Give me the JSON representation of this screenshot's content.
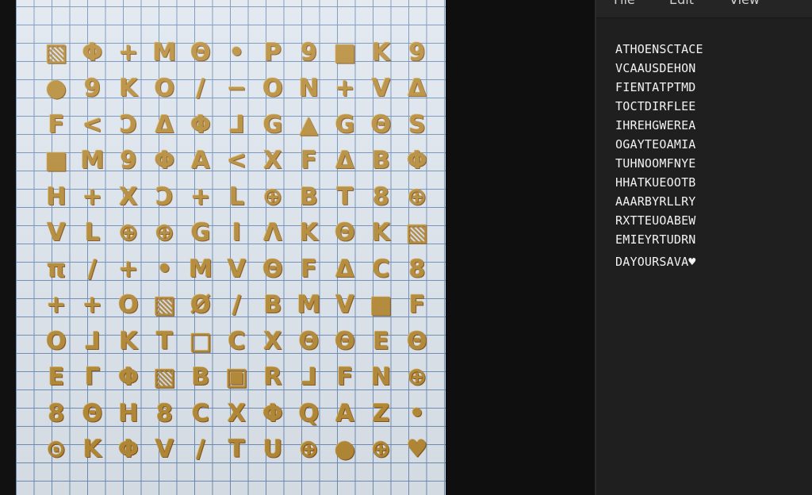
{
  "menu": [
    "File",
    "Edit",
    "View"
  ],
  "lines": [
    "ATHOENSCTACE",
    "VCAAUSDEHON",
    "FIENTATPTMD",
    "TOCTDIRFLEE",
    "IHREHGWEREA",
    "OGAYTEOAMIA",
    "TUHNOOMFNYE",
    "HHATKUEOOTB",
    "AAARBYRLLRY",
    "RXTTEUOABEW",
    "EMIEYRTUDRN",
    "DAYOURSAVA♥"
  ],
  "glyph_rows": [
    [
      "▧",
      "Φ",
      "+",
      "M",
      "Θ",
      "•",
      "P",
      "9",
      "■",
      "K",
      "9"
    ],
    [
      "●",
      "9",
      "K",
      "O",
      "/",
      "−",
      "O",
      "N",
      "+",
      "V",
      "Δ"
    ],
    [
      "F",
      "<",
      "Ɔ",
      "Δ",
      "Φ",
      "⅃",
      "G",
      "▲",
      "G",
      "Θ",
      "S"
    ],
    [
      "■",
      "M",
      "9",
      "Φ",
      "A",
      "<",
      "X",
      "F",
      "Δ",
      "B",
      "Φ"
    ],
    [
      "H",
      "+",
      "X",
      "Ɔ",
      "+",
      "L",
      "⊕",
      "B",
      "T",
      "8",
      "⊕"
    ],
    [
      "V",
      "L",
      "⊕",
      "⊕",
      "G",
      "I",
      "Λ",
      "K",
      "Θ",
      "K",
      "▧"
    ],
    [
      "π",
      "/",
      "+",
      "•",
      "M",
      "V",
      "Θ",
      "F",
      "Δ",
      "C",
      "8"
    ],
    [
      "+",
      "+",
      "O",
      "▧",
      "Ø",
      "/",
      "B",
      "M",
      "V",
      "■",
      "F"
    ],
    [
      "O",
      "⅃",
      "K",
      "T",
      "□",
      "C",
      "X",
      "Θ",
      "Θ",
      "E",
      "Θ"
    ],
    [
      "E",
      "Γ",
      "Φ",
      "▧",
      "B",
      "▣",
      "R",
      "⅃",
      "F",
      "N",
      "⊕"
    ],
    [
      "8",
      "Θ",
      "H",
      "8",
      "C",
      "X",
      "Φ",
      "Q",
      "A",
      "Z",
      "•"
    ],
    [
      "⊙",
      "K",
      "Φ",
      "V",
      "/",
      "T",
      "U",
      "⊕",
      "●",
      "⊕",
      "♥"
    ]
  ]
}
